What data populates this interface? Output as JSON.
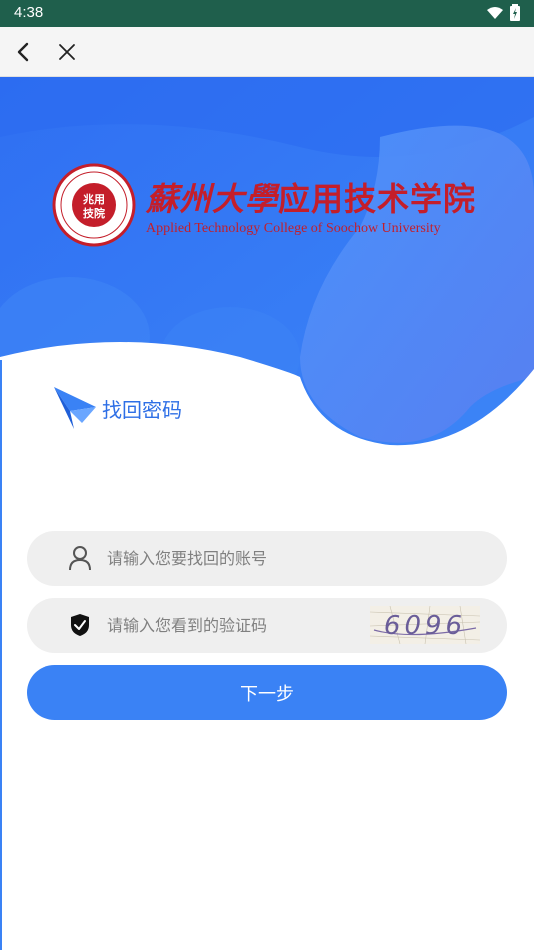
{
  "status_bar": {
    "time": "4:38"
  },
  "nav": {
    "back_icon": "chevron-left-icon",
    "close_icon": "close-icon"
  },
  "logo": {
    "seal_text": "兆用技院",
    "cn_calligraphy": "蘇州大學",
    "cn_name": "应用技术学院",
    "en_name": "Applied Technology College of Soochow University"
  },
  "page": {
    "title": "找回密码"
  },
  "form": {
    "account": {
      "placeholder": "请输入您要找回的账号",
      "value": ""
    },
    "captcha": {
      "placeholder": "请输入您看到的验证码",
      "value": "",
      "image_text": "6096"
    },
    "submit_label": "下一步"
  },
  "colors": {
    "primary": "#3a82f5",
    "logo_red": "#c41e2a",
    "status_bar": "#1f5f4c"
  }
}
